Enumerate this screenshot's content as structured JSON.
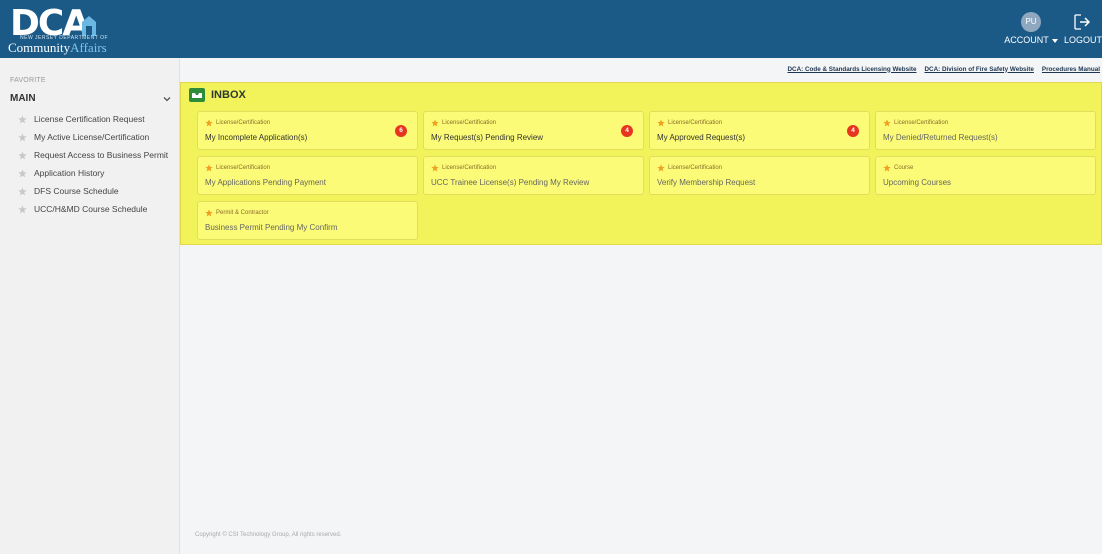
{
  "header": {
    "logo_text": "DCA",
    "logo_sub_prefix": "Community",
    "logo_sub_suffix": "Affairs",
    "logo_tiny": "NEW JERSEY DEPARTMENT OF",
    "account": {
      "initials": "PU",
      "label": "ACCOUNT"
    },
    "logout": {
      "label": "LOGOUT"
    },
    "bg_color": "#1b5a87"
  },
  "sidebar": {
    "favorite_label": "FAVORITE",
    "section_label": "MAIN",
    "items": [
      {
        "label": "License Certification Request"
      },
      {
        "label": "My Active License/Certification"
      },
      {
        "label": "Request Access to Business Permit"
      },
      {
        "label": "Application History"
      },
      {
        "label": "DFS Course Schedule"
      },
      {
        "label": "UCC/H&MD Course Schedule"
      }
    ]
  },
  "top_links": [
    {
      "label": "DCA: Code & Standards Licensing Website"
    },
    {
      "label": "DCA: Division of Fire Safety Website"
    },
    {
      "label": "Procedures Manual"
    }
  ],
  "inbox": {
    "title": "INBOX",
    "bg_color": "#f2f25a",
    "badge_color": "#e8351f",
    "cards": [
      {
        "category": "License/Certification",
        "title": "My Incomplete Application(s)",
        "badge": "6"
      },
      {
        "category": "License/Certification",
        "title": "My Request(s) Pending Review",
        "badge": "4"
      },
      {
        "category": "License/Certification",
        "title": "My Approved Request(s)",
        "badge": "4"
      },
      {
        "category": "License/Certification",
        "title": "My Denied/Returned Request(s)",
        "badge": ""
      },
      {
        "category": "License/Certification",
        "title": "My Applications Pending Payment",
        "badge": ""
      },
      {
        "category": "License/Certification",
        "title": "UCC Trainee License(s) Pending My Review",
        "badge": ""
      },
      {
        "category": "License/Certification",
        "title": "Verify Membership Request",
        "badge": ""
      },
      {
        "category": "Course",
        "title": "Upcoming Courses",
        "badge": ""
      },
      {
        "category": "Permit & Contractor",
        "title": "Business Permit Pending My Confirm",
        "badge": ""
      }
    ]
  },
  "footer": {
    "copyright": "Copyright © CSI Technology Group, All rights reserved."
  }
}
